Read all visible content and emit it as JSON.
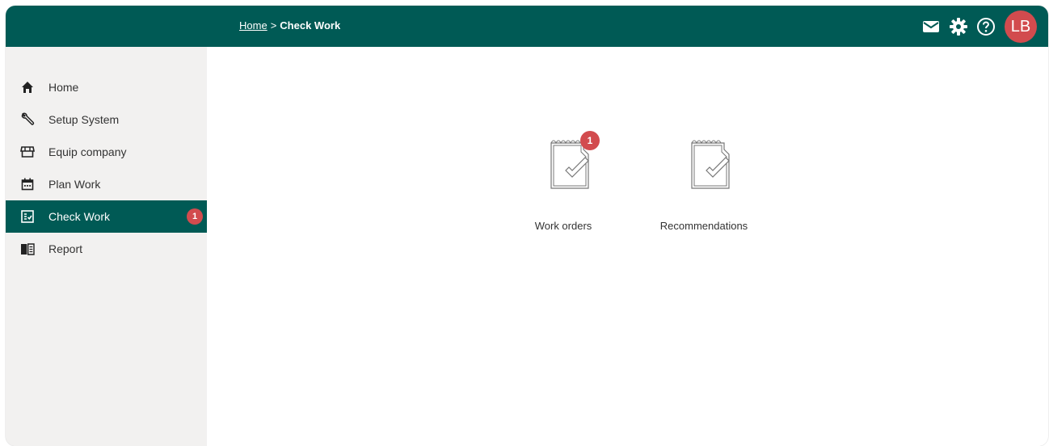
{
  "header": {
    "breadcrumb": {
      "home": "Home",
      "separator": ">",
      "current": "Check Work"
    },
    "icons": [
      "mail-icon",
      "gear-icon",
      "help-icon"
    ],
    "avatar_initials": "LB",
    "bg_color": "#005a55",
    "accent_color": "#d24b4e"
  },
  "sidebar": {
    "items": [
      {
        "label": "Home",
        "icon": "home-icon"
      },
      {
        "label": "Setup System",
        "icon": "wrench-icon"
      },
      {
        "label": "Equip company",
        "icon": "store-icon"
      },
      {
        "label": "Plan Work",
        "icon": "calendar-icon"
      },
      {
        "label": "Check Work",
        "icon": "checklist-icon",
        "active": true,
        "badge": "1"
      },
      {
        "label": "Report",
        "icon": "book-icon"
      }
    ]
  },
  "main": {
    "tiles": [
      {
        "label": "Work orders",
        "icon": "notepad-check-icon",
        "badge": "1"
      },
      {
        "label": "Recommendations",
        "icon": "notepad-check-icon"
      }
    ]
  }
}
